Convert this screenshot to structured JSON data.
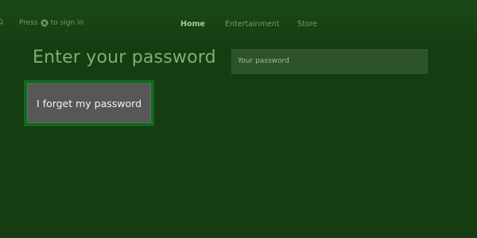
{
  "header": {
    "signin_prefix": "Press",
    "signin_suffix": "to sign in",
    "signin_icon": "xbox-logo-icon"
  },
  "nav": {
    "items": [
      {
        "label": "Home",
        "active": true
      },
      {
        "label": "Entertainment",
        "active": false
      },
      {
        "label": "Store",
        "active": false
      }
    ]
  },
  "main": {
    "title": "Enter your password",
    "password_placeholder": "Your password",
    "forgot_button_label": "I forget my password"
  },
  "colors": {
    "background": "#163d12",
    "accent_focus": "#0f6b1f",
    "button_fill": "#575757"
  }
}
